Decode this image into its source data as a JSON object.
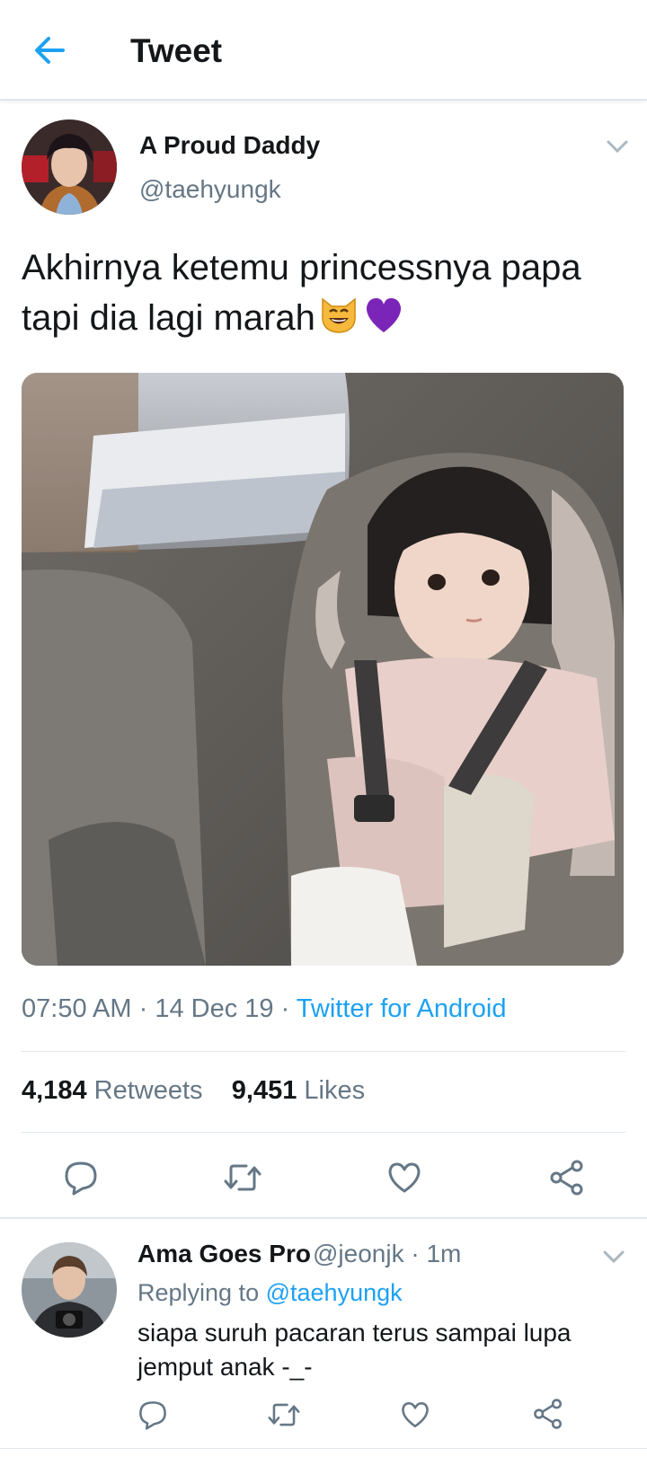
{
  "header": {
    "title": "Tweet"
  },
  "tweet": {
    "author_name": "A Proud Daddy",
    "author_handle": "@taehyungk",
    "text": "Akhirnya ketemu princessnya papa tapi dia lagi marah",
    "emojis": [
      "grinning-cat-emoji",
      "purple-heart-emoji"
    ],
    "time": "07:50 AM",
    "date": "14 Dec 19",
    "source": "Twitter for Android",
    "retweets_count": "4,184",
    "retweets_label": "Retweets",
    "likes_count": "9,451",
    "likes_label": "Likes",
    "media_description_icon": "photo"
  },
  "reply": {
    "author_name": "Ama Goes Pro",
    "author_handle": "@jeonjk",
    "time_ago": "1m",
    "replying_to_label": "Replying to",
    "replying_to_handle": "@taehyungk",
    "text": "siapa suruh pacaran terus sampai lupa jemput anak -_-"
  },
  "colors": {
    "accent": "#1da1f2",
    "text": "#14171a",
    "secondary": "#657786",
    "divider": "#e1e8ed"
  }
}
